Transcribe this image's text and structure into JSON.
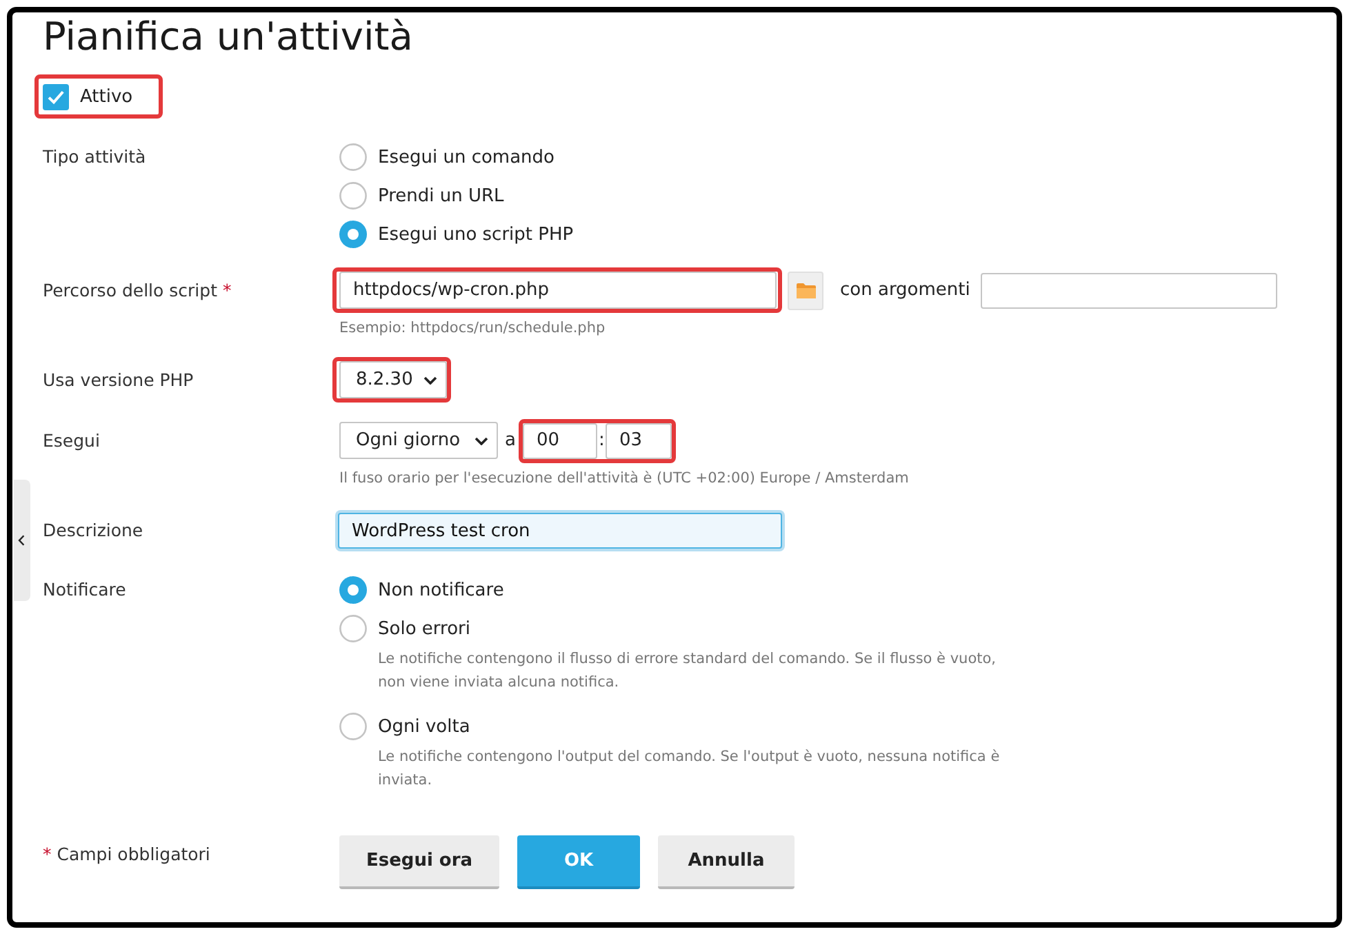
{
  "title": "Pianifica un'attività",
  "active": {
    "label": "Attivo",
    "checked": true,
    "highlighted": true
  },
  "task_type": {
    "label": "Tipo attività",
    "options": [
      {
        "label": "Esegui un comando",
        "selected": false
      },
      {
        "label": "Prendi un URL",
        "selected": false
      },
      {
        "label": "Esegui uno script PHP",
        "selected": true
      }
    ]
  },
  "script_path": {
    "label": "Percorso dello script",
    "required_mark": "*",
    "value": "httpdocs/wp-cron.php",
    "highlighted": true,
    "arguments_label": "con argomenti",
    "hint": "Esempio: httpdocs/run/schedule.php"
  },
  "php_version": {
    "label": "Usa versione PHP",
    "value": "8.2.30",
    "highlighted": true
  },
  "run": {
    "label": "Esegui",
    "frequency": "Ogni giorno",
    "at_label": "a",
    "hour": "00",
    "separator": ":",
    "minute": "03",
    "highlighted": true,
    "hint": "Il fuso orario per l'esecuzione dell'attività è (UTC +02:00) Europe / Amsterdam"
  },
  "description": {
    "label": "Descrizione",
    "value": "WordPress test cron",
    "focused": true
  },
  "notify": {
    "label": "Notificare",
    "options": [
      {
        "label": "Non notificare",
        "selected": true
      },
      {
        "label": "Solo errori",
        "selected": false,
        "hint": "Le notifiche contengono il flusso di errore standard del comando. Se il flusso è vuoto, non viene inviata alcuna notifica."
      },
      {
        "label": "Ogni volta",
        "selected": false,
        "hint": "Le notifiche contengono l'output del comando. Se l'output è vuoto, nessuna notifica è inviata."
      }
    ]
  },
  "footer": {
    "required_mark": "*",
    "required_note": "Campi obbligatori",
    "buttons": [
      {
        "label": "Esegui ora",
        "kind": "secondary"
      },
      {
        "label": "OK",
        "kind": "primary"
      },
      {
        "label": "Annulla",
        "kind": "secondary"
      }
    ]
  }
}
